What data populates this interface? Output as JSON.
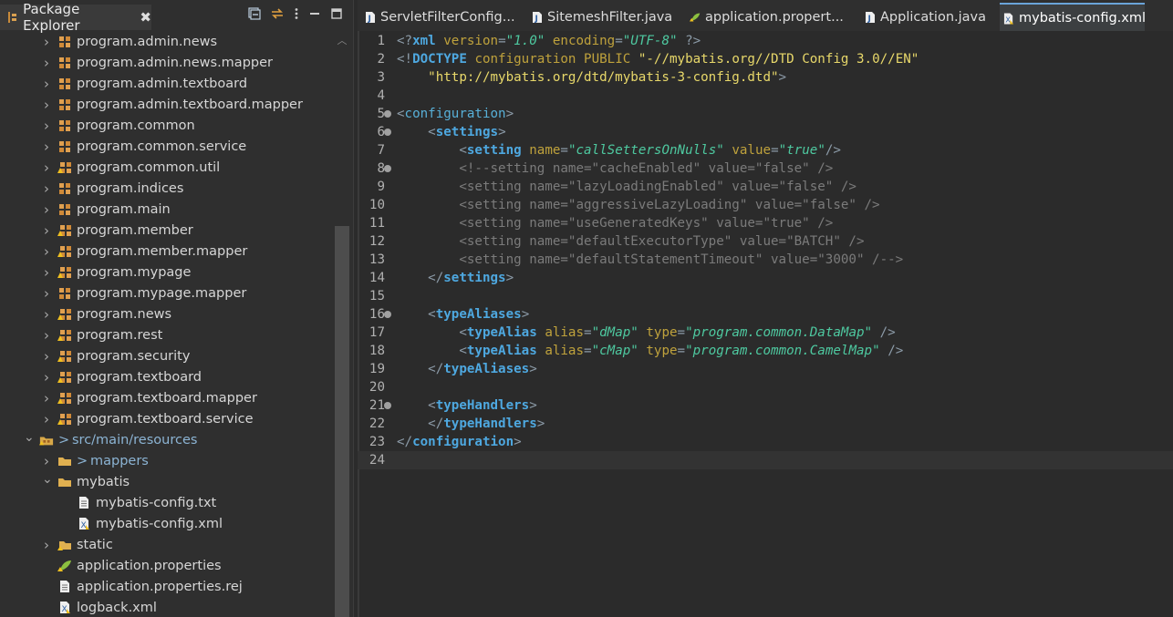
{
  "explorer": {
    "title": "Package Explorer",
    "close_glyph": "✖",
    "tools": [
      "collapse-all-icon",
      "link-with-editor-icon",
      "view-menu-icon",
      "minimize-icon",
      "maximize-icon"
    ],
    "items": [
      {
        "label": "program.admin.news",
        "depth": 1,
        "arrow": "right",
        "icon": "package-icon"
      },
      {
        "label": "program.admin.news.mapper",
        "depth": 1,
        "arrow": "right",
        "icon": "package-icon"
      },
      {
        "label": "program.admin.textboard",
        "depth": 1,
        "arrow": "right",
        "icon": "package-icon"
      },
      {
        "label": "program.admin.textboard.mapper",
        "depth": 1,
        "arrow": "right",
        "icon": "package-icon"
      },
      {
        "label": "program.common",
        "depth": 1,
        "arrow": "right",
        "icon": "package-icon"
      },
      {
        "label": "program.common.service",
        "depth": 1,
        "arrow": "right",
        "icon": "package-icon"
      },
      {
        "label": "program.common.util",
        "depth": 1,
        "arrow": "right",
        "icon": "package-warn-icon"
      },
      {
        "label": "program.indices",
        "depth": 1,
        "arrow": "right",
        "icon": "package-icon"
      },
      {
        "label": "program.main",
        "depth": 1,
        "arrow": "right",
        "icon": "package-icon"
      },
      {
        "label": "program.member",
        "depth": 1,
        "arrow": "right",
        "icon": "package-warn-icon"
      },
      {
        "label": "program.member.mapper",
        "depth": 1,
        "arrow": "right",
        "icon": "package-warn-icon"
      },
      {
        "label": "program.mypage",
        "depth": 1,
        "arrow": "right",
        "icon": "package-warn-icon"
      },
      {
        "label": "program.mypage.mapper",
        "depth": 1,
        "arrow": "right",
        "icon": "package-icon"
      },
      {
        "label": "program.news",
        "depth": 1,
        "arrow": "right",
        "icon": "package-warn-icon"
      },
      {
        "label": "program.rest",
        "depth": 1,
        "arrow": "right",
        "icon": "package-warn-icon"
      },
      {
        "label": "program.security",
        "depth": 1,
        "arrow": "right",
        "icon": "package-warn-icon"
      },
      {
        "label": "program.textboard",
        "depth": 1,
        "arrow": "right",
        "icon": "package-warn-icon"
      },
      {
        "label": "program.textboard.mapper",
        "depth": 1,
        "arrow": "right",
        "icon": "package-warn-icon"
      },
      {
        "label": "program.textboard.service",
        "depth": 1,
        "arrow": "right",
        "icon": "package-warn-icon"
      },
      {
        "label": "src/main/resources",
        "depth": 0,
        "arrow": "down",
        "icon": "source-folder-icon",
        "prefix": ">",
        "blue": true
      },
      {
        "label": "mappers",
        "depth": 1,
        "arrow": "right",
        "icon": "folder-icon",
        "prefix": ">",
        "blue": true
      },
      {
        "label": "mybatis",
        "depth": 1,
        "arrow": "down",
        "icon": "folder-icon"
      },
      {
        "label": "mybatis-config.txt",
        "depth": 2,
        "arrow": "",
        "icon": "text-file-icon"
      },
      {
        "label": "mybatis-config.xml",
        "depth": 2,
        "arrow": "",
        "icon": "xml-file-icon"
      },
      {
        "label": "static",
        "depth": 1,
        "arrow": "right",
        "icon": "folder-warn-icon"
      },
      {
        "label": "application.properties",
        "depth": 1,
        "arrow": "",
        "icon": "properties-file-icon"
      },
      {
        "label": "application.properties.rej",
        "depth": 1,
        "arrow": "",
        "icon": "text-file-icon"
      },
      {
        "label": "logback.xml",
        "depth": 1,
        "arrow": "",
        "icon": "xml-file-icon"
      }
    ]
  },
  "editor_tabs": [
    {
      "label": "ServletFilterConfig...",
      "icon": "java-file-icon",
      "active": false
    },
    {
      "label": "SitemeshFilter.java",
      "icon": "java-file-icon",
      "active": false
    },
    {
      "label": "application.propert...",
      "icon": "properties-file-icon",
      "active": false
    },
    {
      "label": "Application.java",
      "icon": "java-file-icon",
      "active": false
    },
    {
      "label": "mybatis-config.xml",
      "icon": "xml-file-icon",
      "active": true
    }
  ],
  "code": [
    {
      "n": "1",
      "fold": false,
      "tokens": [
        [
          "punct",
          "<?"
        ],
        [
          "tagb",
          "xml"
        ],
        [
          "text",
          " "
        ],
        [
          "attr",
          "version"
        ],
        [
          "punct",
          "="
        ],
        [
          "val",
          "\"1.0\""
        ],
        [
          "text",
          " "
        ],
        [
          "attr",
          "encoding"
        ],
        [
          "punct",
          "="
        ],
        [
          "val",
          "\"UTF-8\""
        ],
        [
          "text",
          " "
        ],
        [
          "punct",
          "?>"
        ]
      ]
    },
    {
      "n": "2",
      "fold": false,
      "tokens": [
        [
          "punct",
          "<!"
        ],
        [
          "kw",
          "DOCTYPE"
        ],
        [
          "text",
          " "
        ],
        [
          "doc",
          "configuration"
        ],
        [
          "text",
          " "
        ],
        [
          "doc",
          "PUBLIC"
        ],
        [
          "text",
          " "
        ],
        [
          "str",
          "\"-//mybatis.org//DTD Config 3.0//EN\""
        ]
      ]
    },
    {
      "n": "3",
      "fold": false,
      "tokens": [
        [
          "text",
          "    "
        ],
        [
          "str",
          "\"http://mybatis.org/dtd/mybatis-3-config.dtd\""
        ],
        [
          "punct",
          ">"
        ]
      ]
    },
    {
      "n": "4",
      "fold": false,
      "tokens": []
    },
    {
      "n": "5",
      "fold": true,
      "tokens": [
        [
          "punct",
          "<"
        ],
        [
          "tag",
          "configuration"
        ],
        [
          "punct",
          ">"
        ]
      ]
    },
    {
      "n": "6",
      "fold": true,
      "tokens": [
        [
          "text",
          "    "
        ],
        [
          "punct",
          "<"
        ],
        [
          "tagb",
          "settings"
        ],
        [
          "punct",
          ">"
        ]
      ]
    },
    {
      "n": "7",
      "fold": false,
      "tokens": [
        [
          "text",
          "        "
        ],
        [
          "punct",
          "<"
        ],
        [
          "tagb",
          "setting"
        ],
        [
          "text",
          " "
        ],
        [
          "attr",
          "name"
        ],
        [
          "punct",
          "="
        ],
        [
          "val",
          "\"callSettersOnNulls\""
        ],
        [
          "text",
          " "
        ],
        [
          "attr",
          "value"
        ],
        [
          "punct",
          "="
        ],
        [
          "val",
          "\"true\""
        ],
        [
          "punct",
          "/>"
        ]
      ]
    },
    {
      "n": "8",
      "fold": true,
      "tokens": [
        [
          "text",
          "        "
        ],
        [
          "com",
          "<!--setting name=\"cacheEnabled\" value=\"false\" />"
        ]
      ]
    },
    {
      "n": "9",
      "fold": false,
      "tokens": [
        [
          "text",
          "        "
        ],
        [
          "com",
          "<setting name=\"lazyLoadingEnabled\" value=\"false\" />"
        ]
      ]
    },
    {
      "n": "10",
      "fold": false,
      "tokens": [
        [
          "text",
          "        "
        ],
        [
          "com",
          "<setting name=\"aggressiveLazyLoading\" value=\"false\" />"
        ]
      ]
    },
    {
      "n": "11",
      "fold": false,
      "tokens": [
        [
          "text",
          "        "
        ],
        [
          "com",
          "<setting name=\"useGeneratedKeys\" value=\"true\" />"
        ]
      ]
    },
    {
      "n": "12",
      "fold": false,
      "tokens": [
        [
          "text",
          "        "
        ],
        [
          "com",
          "<setting name=\"defaultExecutorType\" value=\"BATCH\" />"
        ]
      ]
    },
    {
      "n": "13",
      "fold": false,
      "tokens": [
        [
          "text",
          "        "
        ],
        [
          "com",
          "<setting name=\"defaultStatementTimeout\" value=\"3000\" /-->"
        ]
      ]
    },
    {
      "n": "14",
      "fold": false,
      "tokens": [
        [
          "text",
          "    "
        ],
        [
          "punct",
          "</"
        ],
        [
          "tagb",
          "settings"
        ],
        [
          "punct",
          ">"
        ]
      ]
    },
    {
      "n": "15",
      "fold": false,
      "tokens": []
    },
    {
      "n": "16",
      "fold": true,
      "tokens": [
        [
          "text",
          "    "
        ],
        [
          "punct",
          "<"
        ],
        [
          "tagb",
          "typeAliases"
        ],
        [
          "punct",
          ">"
        ]
      ]
    },
    {
      "n": "17",
      "fold": false,
      "tokens": [
        [
          "text",
          "        "
        ],
        [
          "punct",
          "<"
        ],
        [
          "tagb",
          "typeAlias"
        ],
        [
          "text",
          " "
        ],
        [
          "attr",
          "alias"
        ],
        [
          "punct",
          "="
        ],
        [
          "val",
          "\"dMap\""
        ],
        [
          "text",
          " "
        ],
        [
          "attr",
          "type"
        ],
        [
          "punct",
          "="
        ],
        [
          "val",
          "\"program.common.DataMap\""
        ],
        [
          "text",
          " "
        ],
        [
          "punct",
          "/>"
        ]
      ]
    },
    {
      "n": "18",
      "fold": false,
      "tokens": [
        [
          "text",
          "        "
        ],
        [
          "punct",
          "<"
        ],
        [
          "tagb",
          "typeAlias"
        ],
        [
          "text",
          " "
        ],
        [
          "attr",
          "alias"
        ],
        [
          "punct",
          "="
        ],
        [
          "val",
          "\"cMap\""
        ],
        [
          "text",
          " "
        ],
        [
          "attr",
          "type"
        ],
        [
          "punct",
          "="
        ],
        [
          "val",
          "\"program.common.CamelMap\""
        ],
        [
          "text",
          " "
        ],
        [
          "punct",
          "/>"
        ]
      ]
    },
    {
      "n": "19",
      "fold": false,
      "tokens": [
        [
          "text",
          "    "
        ],
        [
          "punct",
          "</"
        ],
        [
          "tagb",
          "typeAliases"
        ],
        [
          "punct",
          ">"
        ]
      ]
    },
    {
      "n": "20",
      "fold": false,
      "tokens": []
    },
    {
      "n": "21",
      "fold": true,
      "tokens": [
        [
          "text",
          "    "
        ],
        [
          "punct",
          "<"
        ],
        [
          "tagb",
          "typeHandlers"
        ],
        [
          "punct",
          ">"
        ]
      ]
    },
    {
      "n": "22",
      "fold": false,
      "tokens": [
        [
          "text",
          "    "
        ],
        [
          "punct",
          "</"
        ],
        [
          "tagb",
          "typeHandlers"
        ],
        [
          "punct",
          ">"
        ]
      ]
    },
    {
      "n": "23",
      "fold": false,
      "tokens": [
        [
          "punct",
          "</"
        ],
        [
          "tagb",
          "configuration"
        ],
        [
          "punct",
          ">"
        ]
      ]
    },
    {
      "n": "24",
      "fold": false,
      "tokens": [],
      "current": true
    }
  ]
}
